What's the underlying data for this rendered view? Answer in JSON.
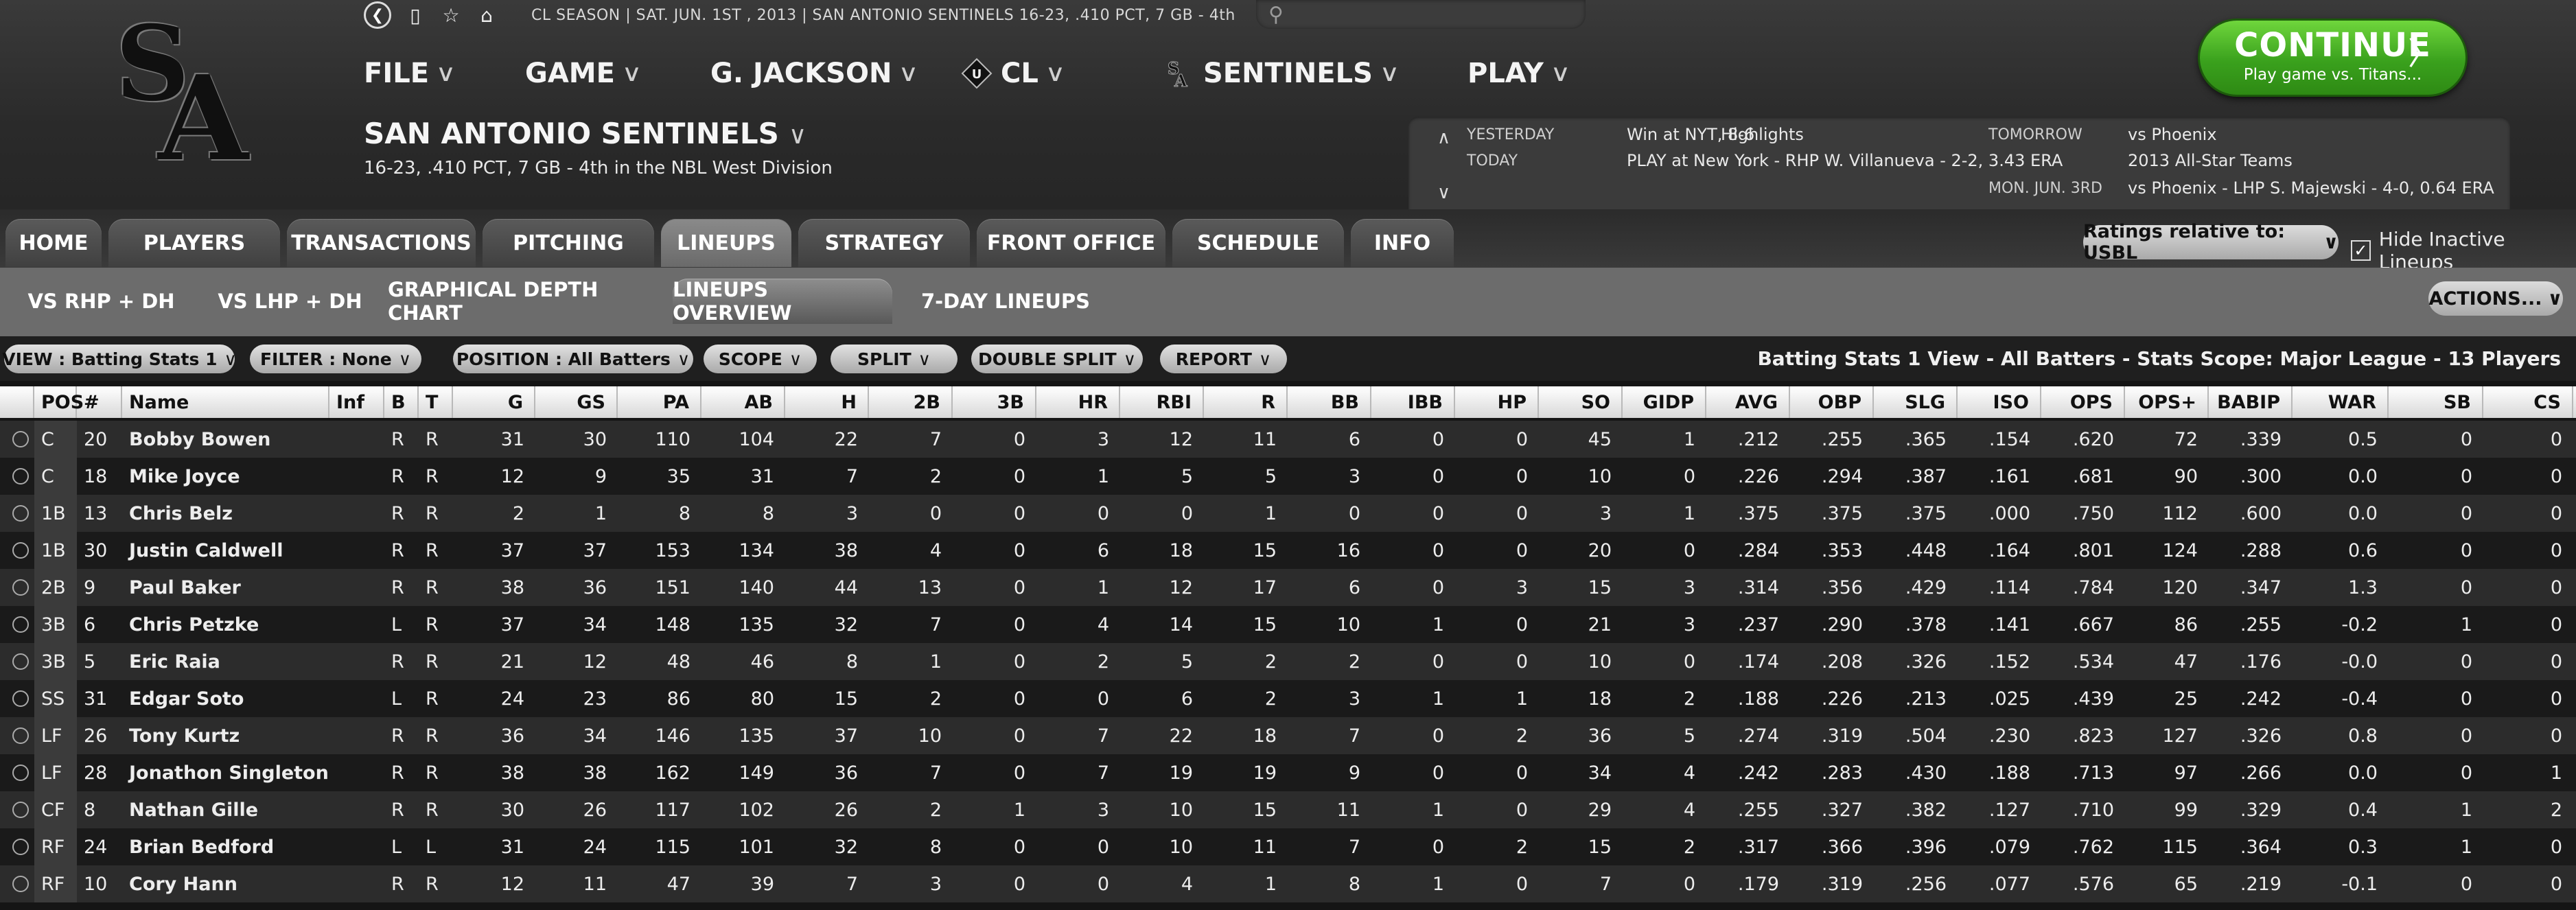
{
  "topbar": {
    "season_info": "CL SEASON  |  SAT. JUN. 1ST , 2013  |  SAN ANTONIO SENTINELS   16-23, .410 PCT, 7 GB - 4th",
    "search_placeholder": ""
  },
  "logo": {
    "text_top": "S",
    "text_bottom": "A"
  },
  "main_menu": [
    {
      "label": "FILE"
    },
    {
      "label": "GAME"
    },
    {
      "label": "G. JACKSON"
    },
    {
      "label": "CL"
    },
    {
      "label": "SENTINELS"
    },
    {
      "label": "PLAY"
    }
  ],
  "team": {
    "name": "SAN ANTONIO SENTINELS",
    "subtitle": "16-23, .410 PCT, 7 GB - 4th in the NBL West Division"
  },
  "continue": {
    "title": "CONTINUE",
    "subtitle": "Play game vs. Titans..."
  },
  "schedule": {
    "yesterday_label": "YESTERDAY",
    "yesterday_result": "Win at NYT, 8-6",
    "highlights": "Highlights",
    "today_label": "TODAY",
    "today_text": "PLAY at New York - RHP W. Villanueva - 2-2, 3.43 ERA",
    "tomorrow_label": "TOMORROW",
    "tomorrow_text": "vs Phoenix",
    "allstar_text": "2013 All-Star Teams",
    "mon_label": "MON. JUN. 3RD",
    "mon_text": "vs Phoenix - LHP S. Majewski - 4-0, 0.64 ERA"
  },
  "tabs": [
    "HOME",
    "PLAYERS",
    "TRANSACTIONS",
    "PITCHING",
    "LINEUPS",
    "STRATEGY",
    "FRONT OFFICE",
    "SCHEDULE",
    "INFO"
  ],
  "ratings_relative": "Ratings relative to: USBL",
  "hide_inactive": "Hide Inactive Lineups",
  "subtabs": [
    "VS RHP + DH",
    "VS LHP + DH",
    "GRAPHICAL DEPTH CHART",
    "LINEUPS OVERVIEW",
    "7-DAY LINEUPS"
  ],
  "actions_label": "ACTIONS...",
  "filters": [
    {
      "label": "VIEW : Batting Stats 1"
    },
    {
      "label": "FILTER : None"
    },
    {
      "label": "POSITION : All Batters"
    },
    {
      "label": "SCOPE"
    },
    {
      "label": "SPLIT"
    },
    {
      "label": "DOUBLE SPLIT"
    },
    {
      "label": "REPORT"
    }
  ],
  "view_summary": "Batting Stats 1 View - All Batters - Stats Scope: Major League - 13 Players",
  "columns": [
    "POS",
    "#",
    "Name",
    "Inf",
    "B",
    "T",
    "G",
    "GS",
    "PA",
    "AB",
    "H",
    "2B",
    "3B",
    "HR",
    "RBI",
    "R",
    "BB",
    "IBB",
    "HP",
    "SO",
    "GIDP",
    "AVG",
    "OBP",
    "SLG",
    "ISO",
    "OPS",
    "OPS+",
    "BABIP",
    "WAR",
    "SB",
    "CS"
  ],
  "players": [
    {
      "pos": "C",
      "num": "20",
      "name": "Bobby Bowen",
      "link": true,
      "b": "R",
      "t": "R",
      "g": "31",
      "gs": "30",
      "pa": "110",
      "ab": "104",
      "h": "22",
      "d": "7",
      "tr": "0",
      "hr": "3",
      "rbi": "12",
      "r": "11",
      "bb": "6",
      "ibb": "0",
      "hp": "0",
      "so": "45",
      "gidp": "1",
      "avg": ".212",
      "obp": ".255",
      "slg": ".365",
      "iso": ".154",
      "ops": ".620",
      "opsp": "72",
      "babip": ".339",
      "war": "0.5",
      "sb": "0",
      "cs": "0"
    },
    {
      "pos": "C",
      "num": "18",
      "name": "Mike Joyce",
      "link": false,
      "b": "R",
      "t": "R",
      "g": "12",
      "gs": "9",
      "pa": "35",
      "ab": "31",
      "h": "7",
      "d": "2",
      "tr": "0",
      "hr": "1",
      "rbi": "5",
      "r": "5",
      "bb": "3",
      "ibb": "0",
      "hp": "0",
      "so": "10",
      "gidp": "0",
      "avg": ".226",
      "obp": ".294",
      "slg": ".387",
      "iso": ".161",
      "ops": ".681",
      "opsp": "90",
      "babip": ".300",
      "war": "0.0",
      "sb": "0",
      "cs": "0"
    },
    {
      "pos": "1B",
      "num": "13",
      "name": "Chris Belz",
      "link": false,
      "b": "R",
      "t": "R",
      "g": "2",
      "gs": "1",
      "pa": "8",
      "ab": "8",
      "h": "3",
      "d": "0",
      "tr": "0",
      "hr": "0",
      "rbi": "0",
      "r": "1",
      "bb": "0",
      "ibb": "0",
      "hp": "0",
      "so": "3",
      "gidp": "1",
      "avg": ".375",
      "obp": ".375",
      "slg": ".375",
      "iso": ".000",
      "ops": ".750",
      "opsp": "112",
      "babip": ".600",
      "war": "0.0",
      "sb": "0",
      "cs": "0"
    },
    {
      "pos": "1B",
      "num": "30",
      "name": "Justin Caldwell",
      "link": true,
      "b": "R",
      "t": "R",
      "g": "37",
      "gs": "37",
      "pa": "153",
      "ab": "134",
      "h": "38",
      "d": "4",
      "tr": "0",
      "hr": "6",
      "rbi": "18",
      "r": "15",
      "bb": "16",
      "ibb": "0",
      "hp": "0",
      "so": "20",
      "gidp": "0",
      "avg": ".284",
      "obp": ".353",
      "slg": ".448",
      "iso": ".164",
      "ops": ".801",
      "opsp": "124",
      "babip": ".288",
      "war": "0.6",
      "sb": "0",
      "cs": "0"
    },
    {
      "pos": "2B",
      "num": "9",
      "name": "Paul Baker",
      "link": true,
      "b": "R",
      "t": "R",
      "g": "38",
      "gs": "36",
      "pa": "151",
      "ab": "140",
      "h": "44",
      "d": "13",
      "tr": "0",
      "hr": "1",
      "rbi": "12",
      "r": "17",
      "bb": "6",
      "ibb": "0",
      "hp": "3",
      "so": "15",
      "gidp": "3",
      "avg": ".314",
      "obp": ".356",
      "slg": ".429",
      "iso": ".114",
      "ops": ".784",
      "opsp": "120",
      "babip": ".347",
      "war": "1.3",
      "sb": "0",
      "cs": "0"
    },
    {
      "pos": "3B",
      "num": "6",
      "name": "Chris Petzke",
      "link": true,
      "b": "L",
      "t": "R",
      "g": "37",
      "gs": "34",
      "pa": "148",
      "ab": "135",
      "h": "32",
      "d": "7",
      "tr": "0",
      "hr": "4",
      "rbi": "14",
      "r": "15",
      "bb": "10",
      "ibb": "1",
      "hp": "0",
      "so": "21",
      "gidp": "3",
      "avg": ".237",
      "obp": ".290",
      "slg": ".378",
      "iso": ".141",
      "ops": ".667",
      "opsp": "86",
      "babip": ".255",
      "war": "-0.2",
      "sb": "1",
      "cs": "0"
    },
    {
      "pos": "3B",
      "num": "5",
      "name": "Eric Raia",
      "link": false,
      "b": "R",
      "t": "R",
      "g": "21",
      "gs": "12",
      "pa": "48",
      "ab": "46",
      "h": "8",
      "d": "1",
      "tr": "0",
      "hr": "2",
      "rbi": "5",
      "r": "2",
      "bb": "2",
      "ibb": "0",
      "hp": "0",
      "so": "10",
      "gidp": "0",
      "avg": ".174",
      "obp": ".208",
      "slg": ".326",
      "iso": ".152",
      "ops": ".534",
      "opsp": "47",
      "babip": ".176",
      "war": "-0.0",
      "sb": "0",
      "cs": "0"
    },
    {
      "pos": "SS",
      "num": "31",
      "name": "Edgar Soto",
      "link": true,
      "b": "L",
      "t": "R",
      "g": "24",
      "gs": "23",
      "pa": "86",
      "ab": "80",
      "h": "15",
      "d": "2",
      "tr": "0",
      "hr": "0",
      "rbi": "6",
      "r": "2",
      "bb": "3",
      "ibb": "1",
      "hp": "1",
      "so": "18",
      "gidp": "2",
      "avg": ".188",
      "obp": ".226",
      "slg": ".213",
      "iso": ".025",
      "ops": ".439",
      "opsp": "25",
      "babip": ".242",
      "war": "-0.4",
      "sb": "0",
      "cs": "0"
    },
    {
      "pos": "LF",
      "num": "26",
      "name": "Tony Kurtz",
      "link": true,
      "b": "R",
      "t": "R",
      "g": "36",
      "gs": "34",
      "pa": "146",
      "ab": "135",
      "h": "37",
      "d": "10",
      "tr": "0",
      "hr": "7",
      "rbi": "22",
      "r": "18",
      "bb": "7",
      "ibb": "0",
      "hp": "2",
      "so": "36",
      "gidp": "5",
      "avg": ".274",
      "obp": ".319",
      "slg": ".504",
      "iso": ".230",
      "ops": ".823",
      "opsp": "127",
      "babip": ".326",
      "war": "0.8",
      "sb": "0",
      "cs": "0"
    },
    {
      "pos": "LF",
      "num": "28",
      "name": "Jonathon Singleton",
      "link": true,
      "b": "R",
      "t": "R",
      "g": "38",
      "gs": "38",
      "pa": "162",
      "ab": "149",
      "h": "36",
      "d": "7",
      "tr": "0",
      "hr": "7",
      "rbi": "19",
      "r": "19",
      "bb": "9",
      "ibb": "0",
      "hp": "0",
      "so": "34",
      "gidp": "4",
      "avg": ".242",
      "obp": ".283",
      "slg": ".430",
      "iso": ".188",
      "ops": ".713",
      "opsp": "97",
      "babip": ".266",
      "war": "0.0",
      "sb": "0",
      "cs": "1"
    },
    {
      "pos": "CF",
      "num": "8",
      "name": "Nathan Gille",
      "link": true,
      "b": "R",
      "t": "R",
      "g": "30",
      "gs": "26",
      "pa": "117",
      "ab": "102",
      "h": "26",
      "d": "2",
      "tr": "1",
      "hr": "3",
      "rbi": "10",
      "r": "15",
      "bb": "11",
      "ibb": "1",
      "hp": "0",
      "so": "29",
      "gidp": "4",
      "avg": ".255",
      "obp": ".327",
      "slg": ".382",
      "iso": ".127",
      "ops": ".710",
      "opsp": "99",
      "babip": ".329",
      "war": "0.4",
      "sb": "1",
      "cs": "2"
    },
    {
      "pos": "RF",
      "num": "24",
      "name": "Brian Bedford",
      "link": false,
      "b": "L",
      "t": "L",
      "g": "31",
      "gs": "24",
      "pa": "115",
      "ab": "101",
      "h": "32",
      "d": "8",
      "tr": "0",
      "hr": "0",
      "rbi": "10",
      "r": "11",
      "bb": "7",
      "ibb": "0",
      "hp": "2",
      "so": "15",
      "gidp": "2",
      "avg": ".317",
      "obp": ".366",
      "slg": ".396",
      "iso": ".079",
      "ops": ".762",
      "opsp": "115",
      "babip": ".364",
      "war": "0.3",
      "sb": "1",
      "cs": "0"
    },
    {
      "pos": "RF",
      "num": "10",
      "name": "Cory Hann",
      "link": true,
      "b": "R",
      "t": "R",
      "g": "12",
      "gs": "11",
      "pa": "47",
      "ab": "39",
      "h": "7",
      "d": "3",
      "tr": "0",
      "hr": "0",
      "rbi": "4",
      "r": "1",
      "bb": "8",
      "ibb": "1",
      "hp": "0",
      "so": "7",
      "gidp": "0",
      "avg": ".179",
      "obp": ".319",
      "slg": ".256",
      "iso": ".077",
      "ops": ".576",
      "opsp": "65",
      "babip": ".219",
      "war": "-0.1",
      "sb": "0",
      "cs": "0"
    }
  ],
  "colors": {
    "accent_green": "#39d154",
    "continue_green": "#3aa11d",
    "background": "#2f2f2f"
  },
  "icons": [
    "back-icon",
    "page-icon",
    "star-icon",
    "home-icon",
    "search-icon",
    "cl-league-icon",
    "sentinels-icon",
    "chevron-down-icon",
    "checkmark-icon"
  ]
}
